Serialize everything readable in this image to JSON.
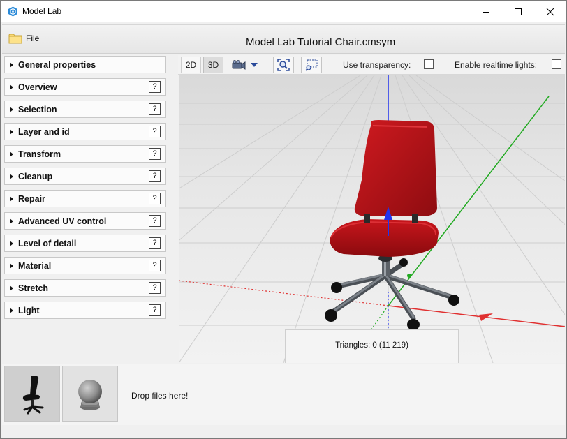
{
  "window": {
    "title": "Model Lab",
    "controls": {
      "minimize": "minimize",
      "maximize": "maximize",
      "close": "close"
    }
  },
  "header": {
    "file_menu_label": "File",
    "document_title": "Model Lab Tutorial Chair.cmsym"
  },
  "sidebar": {
    "sections": [
      {
        "label": "General properties",
        "has_help": false
      },
      {
        "label": "Overview",
        "has_help": true,
        "help": "?"
      },
      {
        "label": "Selection",
        "has_help": true,
        "help": "?"
      },
      {
        "label": "Layer and id",
        "has_help": true,
        "help": "?"
      },
      {
        "label": "Transform",
        "has_help": true,
        "help": "?"
      },
      {
        "label": "Cleanup",
        "has_help": true,
        "help": "?"
      },
      {
        "label": "Repair",
        "has_help": true,
        "help": "?"
      },
      {
        "label": "Advanced UV control",
        "has_help": true,
        "help": "?"
      },
      {
        "label": "Level of detail",
        "has_help": true,
        "help": "?"
      },
      {
        "label": "Material",
        "has_help": true,
        "help": "?"
      },
      {
        "label": "Stretch",
        "has_help": true,
        "help": "?"
      },
      {
        "label": "Light",
        "has_help": true,
        "help": "?"
      }
    ]
  },
  "view_toolbar": {
    "btn_2d": "2D",
    "btn_3d": "3D",
    "active_mode": "3D",
    "camera_icon": "camera-icon",
    "zoom_fit_icon": "zoom-extents-icon",
    "zoom_select_icon": "zoom-selection-icon",
    "transparency_label": "Use transparency:",
    "transparency_checked": false,
    "lights_label": "Enable realtime lights:",
    "lights_checked": false
  },
  "viewport": {
    "triangles_label": "Triangles: 0 (11 219)",
    "axis_colors": {
      "x": "#e03030",
      "y": "#22aa22",
      "z": "#2233ee"
    },
    "chair_color": "#b81218"
  },
  "drop_area": {
    "label": "Drop files here!",
    "thumbnails": [
      "chair-thumbnail",
      "sphere-thumbnail"
    ]
  }
}
